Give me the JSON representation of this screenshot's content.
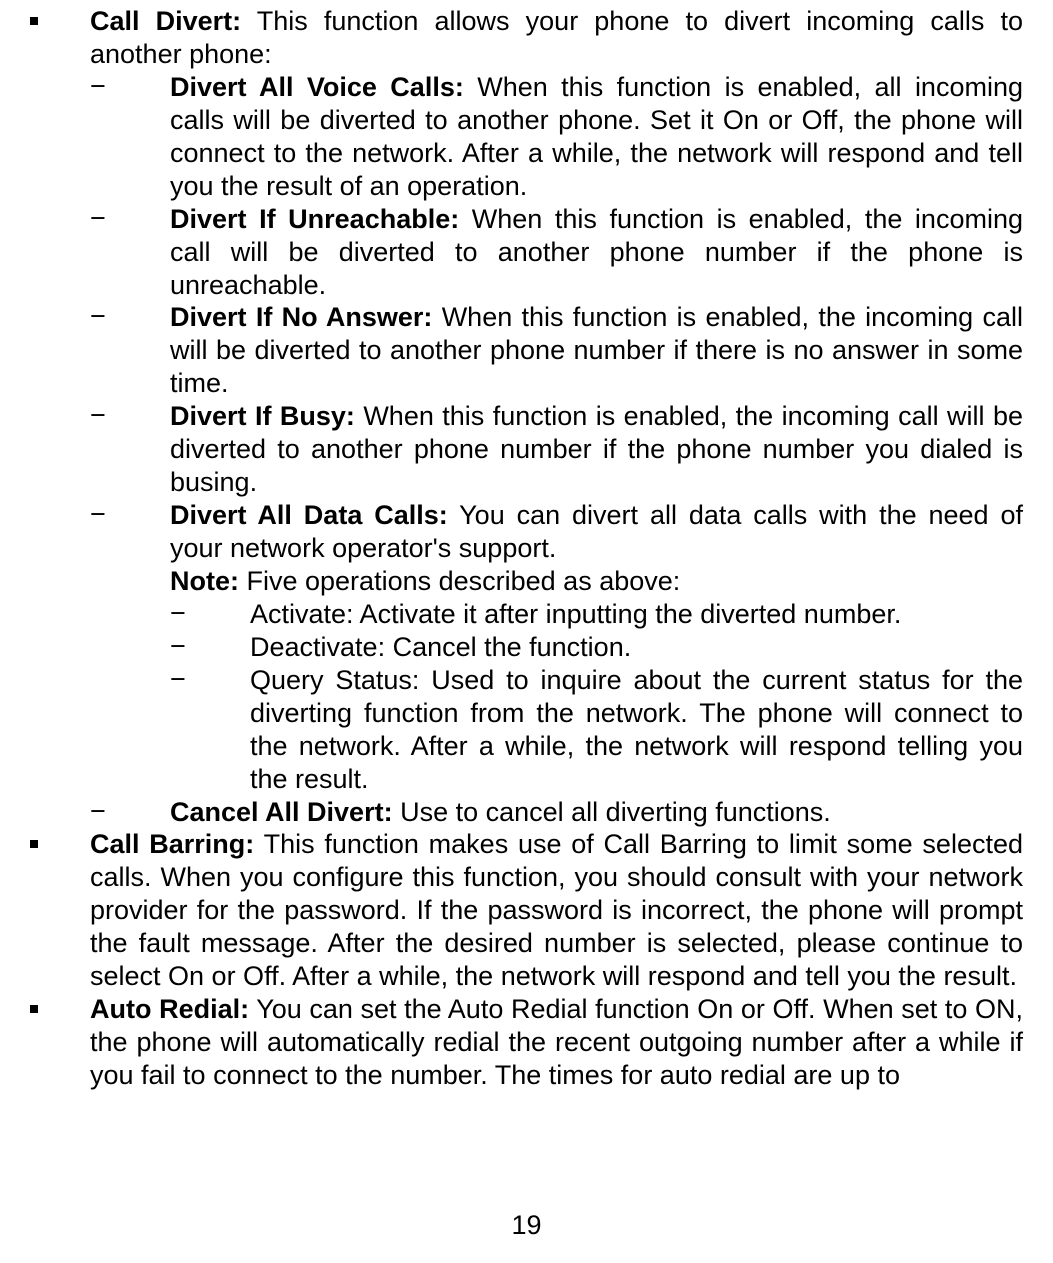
{
  "sections": {
    "callDivert": {
      "title": "Call Divert:",
      "desc": " This function allows your phone to divert incoming calls to another phone:",
      "items": {
        "allVoice": {
          "title": "Divert All Voice Calls:",
          "desc": " When this function is enabled, all incoming calls will be diverted to another phone. Set it On or Off, the phone will connect to the network. After a while, the network will respond and tell you the result of an operation."
        },
        "unreachable": {
          "title": "Divert If Unreachable:",
          "desc": " When this function is enabled, the incoming call will be diverted to another phone number if the phone is unreachable."
        },
        "noAnswer": {
          "title": "Divert If No Answer:",
          "desc": " When this function is enabled, the incoming call will be diverted to another phone number if there is no answer in some time."
        },
        "busy": {
          "title": "Divert If Busy:",
          "desc": " When this function is enabled, the incoming call will be diverted to another phone number if the phone number you dialed is busing."
        },
        "allData": {
          "title": "Divert All Data Calls:",
          "desc": " You can divert all data calls with the need of your network operator's support."
        },
        "noteTitle": "Note:",
        "noteDesc": " Five operations described as above:",
        "ops": {
          "activate": "Activate: Activate it after inputting the diverted number.",
          "deactivate": "Deactivate: Cancel the function.",
          "query": "Query Status: Used to inquire about the current status for the diverting function from the network. The phone will connect to the network. After a while, the network will respond telling you the result."
        },
        "cancelAll": {
          "title": "Cancel All Divert:",
          "desc": " Use to cancel all diverting functions."
        }
      }
    },
    "callBarring": {
      "title": "Call Barring:",
      "desc": " This function makes use of Call Barring to limit some selected calls. When you configure this function, you should consult with your network provider for the password. If the password is incorrect, the phone will prompt the fault message. After the desired number is selected, please continue to select On or Off. After a while, the network will respond and tell you the result."
    },
    "autoRedial": {
      "title": "Auto Redial:",
      "desc": " You can set the Auto Redial function On or Off. When set to ON, the phone will automatically redial the recent outgoing number after a while if you fail to connect to the number. The times for auto redial are up to"
    }
  },
  "pageNumber": "19"
}
